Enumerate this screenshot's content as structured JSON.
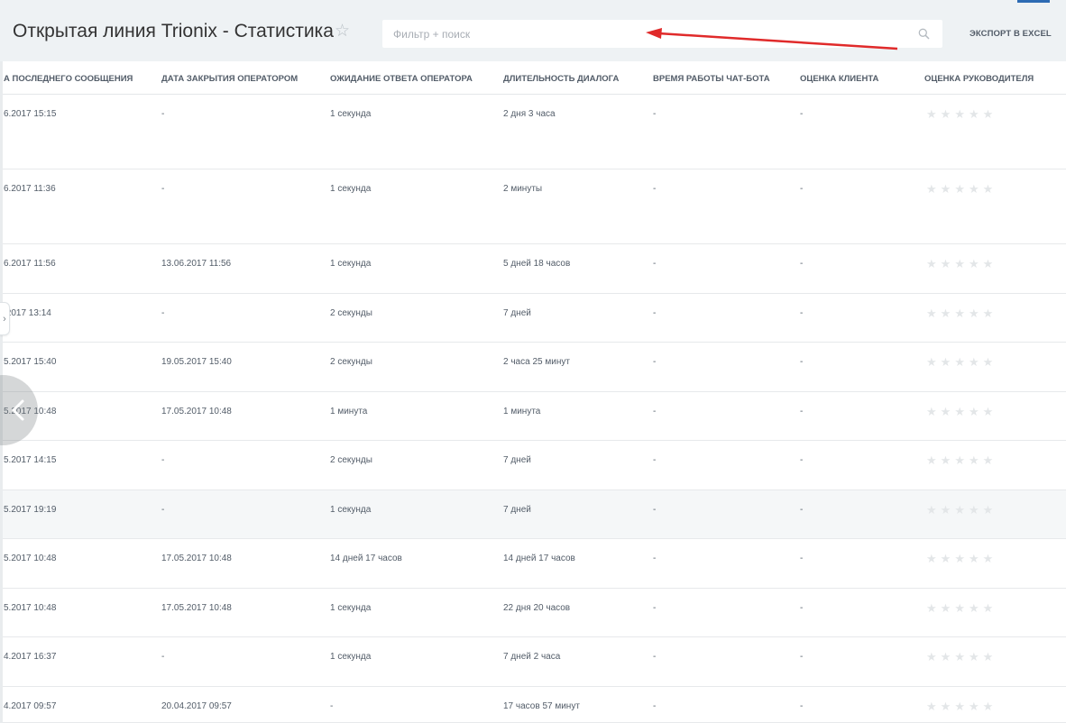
{
  "header": {
    "title": "Открытая линия Trionix - Статистика",
    "favorite_icon": "star-icon",
    "search": {
      "placeholder": "Фильтр + поиск",
      "value": ""
    },
    "export_label": "ЭКСПОРТ В EXCEL",
    "accent_color": "#2d6bb3"
  },
  "annotation": {
    "arrow_color": "#e02a2a"
  },
  "table": {
    "columns": [
      "А ПОСЛЕДНЕГО СООБЩЕНИЯ",
      "ДАТА ЗАКРЫТИЯ ОПЕРАТОРОМ",
      "ОЖИДАНИЕ ОТВЕТА ОПЕРАТОРА",
      "ДЛИТЕЛЬНОСТЬ ДИАЛОГА",
      "ВРЕМЯ РАБОТЫ ЧАТ-БОТА",
      "ОЦЕНКА КЛИЕНТА",
      "ОЦЕНКА РУКОВОДИТЕЛЯ"
    ],
    "rows": [
      {
        "last_message": "6.2017 15:15",
        "closed": "-",
        "wait": "1 секунда",
        "duration": "2 дня 3 часа",
        "bot_time": "-",
        "client_rating": "-",
        "manager_rating": 0
      },
      {
        "last_message": "6.2017 11:36",
        "closed": "-",
        "wait": "1 секунда",
        "duration": "2 минуты",
        "bot_time": "-",
        "client_rating": "-",
        "manager_rating": 0
      },
      {
        "last_message": "6.2017 11:56",
        "closed": "13.06.2017 11:56",
        "wait": "1 секунда",
        "duration": "5 дней 18 часов",
        "bot_time": "-",
        "client_rating": "-",
        "manager_rating": 0
      },
      {
        "last_message": ".2017 13:14",
        "closed": "-",
        "wait": "2 секунды",
        "duration": "7 дней",
        "bot_time": "-",
        "client_rating": "-",
        "manager_rating": 0
      },
      {
        "last_message": "5.2017 15:40",
        "closed": "19.05.2017 15:40",
        "wait": "2 секунды",
        "duration": "2 часа 25 минут",
        "bot_time": "-",
        "client_rating": "-",
        "manager_rating": 0
      },
      {
        "last_message": "5.2017 10:48",
        "closed": "17.05.2017 10:48",
        "wait": "1 минута",
        "duration": "1 минута",
        "bot_time": "-",
        "client_rating": "-",
        "manager_rating": 0
      },
      {
        "last_message": "5.2017 14:15",
        "closed": "-",
        "wait": "2 секунды",
        "duration": "7 дней",
        "bot_time": "-",
        "client_rating": "-",
        "manager_rating": 0
      },
      {
        "last_message": "5.2017 19:19",
        "closed": "-",
        "wait": "1 секунда",
        "duration": "7 дней",
        "bot_time": "-",
        "client_rating": "-",
        "manager_rating": 0
      },
      {
        "last_message": "5.2017 10:48",
        "closed": "17.05.2017 10:48",
        "wait": "14 дней 17 часов",
        "duration": "14 дней 17 часов",
        "bot_time": "-",
        "client_rating": "-",
        "manager_rating": 0
      },
      {
        "last_message": "5.2017 10:48",
        "closed": "17.05.2017 10:48",
        "wait": "1 секунда",
        "duration": "22 дня 20 часов",
        "bot_time": "-",
        "client_rating": "-",
        "manager_rating": 0
      },
      {
        "last_message": "4.2017 16:37",
        "closed": "-",
        "wait": "1 секунда",
        "duration": "7 дней 2 часа",
        "bot_time": "-",
        "client_rating": "-",
        "manager_rating": 0
      },
      {
        "last_message": "4.2017 09:57",
        "closed": "20.04.2017 09:57",
        "wait": "-",
        "duration": "17 часов 57 минут",
        "bot_time": "-",
        "client_rating": "-",
        "manager_rating": 0
      }
    ]
  }
}
